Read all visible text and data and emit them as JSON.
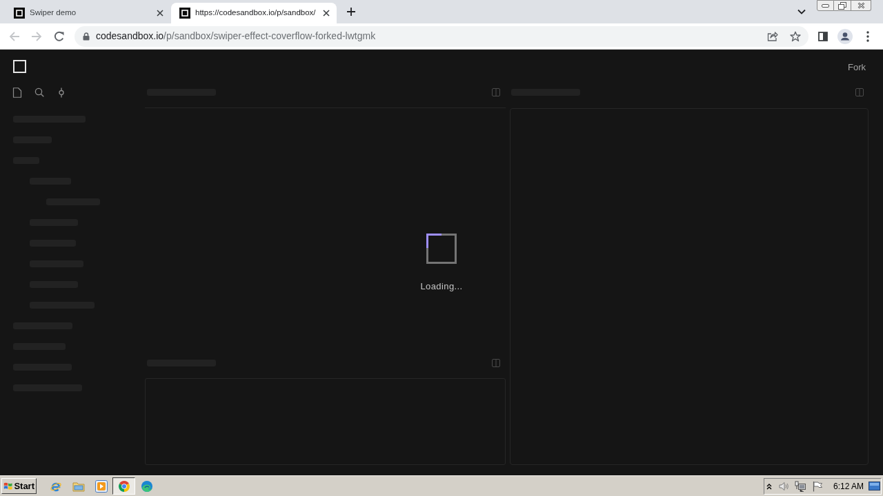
{
  "browser": {
    "tabs": [
      {
        "title": "Swiper demo",
        "selected": false
      },
      {
        "title": "https://codesandbox.io/p/sandbox/",
        "selected": true
      }
    ],
    "navigation": [
      {
        "kind": "back",
        "disabled": true
      },
      {
        "kind": "forward",
        "disabled": true
      },
      {
        "kind": "reload",
        "disabled": false
      }
    ],
    "address": {
      "host": "codesandbox.io",
      "path": "/p/sandbox/swiper-effect-coverflow-forked-lwtgmk"
    }
  },
  "app": {
    "fork_label": "Fork",
    "loading_text": "Loading..."
  },
  "taskbar": {
    "start_label": "Start",
    "apps": [
      {
        "kind": "ie",
        "selected": false
      },
      {
        "kind": "explorer",
        "selected": false
      },
      {
        "kind": "media",
        "selected": false
      },
      {
        "kind": "chrome",
        "selected": true
      },
      {
        "kind": "edge",
        "selected": false
      }
    ],
    "clock": "6:12 AM"
  }
}
